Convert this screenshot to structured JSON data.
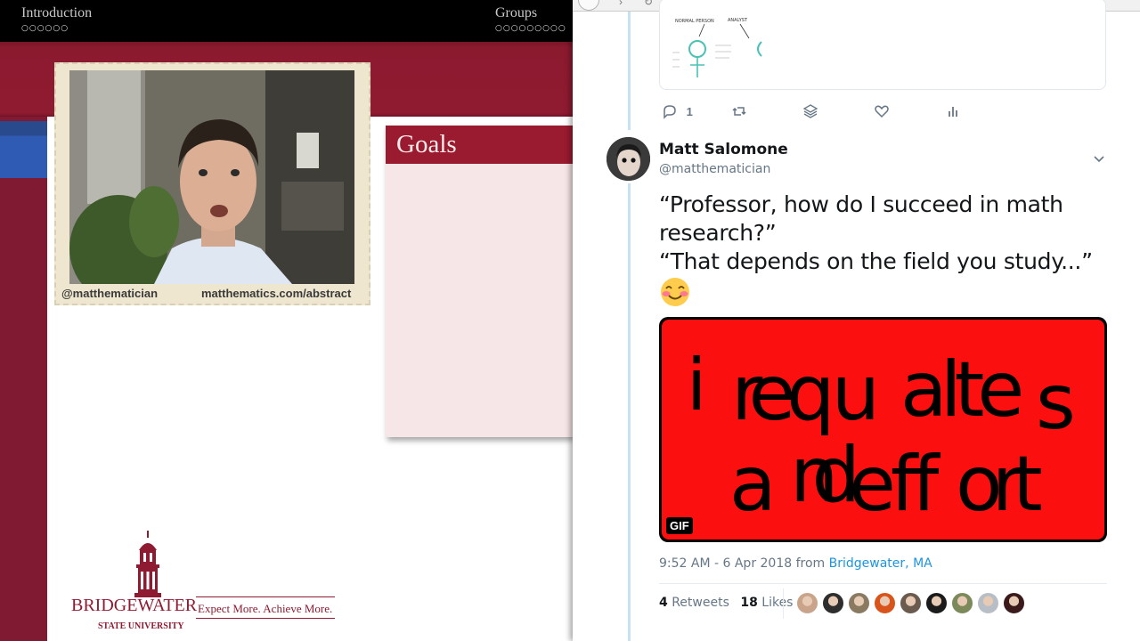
{
  "slide": {
    "nav": {
      "sections": [
        {
          "title": "Introduction",
          "dots": "○○○○○○"
        },
        {
          "title": "Groups",
          "dots": "○○○○○○○○○"
        }
      ]
    },
    "webcam_captions": {
      "handle": "@matthematician",
      "site": "matthematics.com/abstract"
    },
    "goals_title": "Goals",
    "logo": {
      "name": "BRIDGEWATER",
      "tagline": "Expect More. Achieve More.",
      "subtitle": "STATE UNIVERSITY"
    },
    "colors": {
      "maroon": "#8f1b31",
      "nav_black": "#000000",
      "blue_tab": "#2f5bb5"
    }
  },
  "tweet": {
    "quoted": {
      "labels": [
        "NORMAL PERSON",
        "ANALYST"
      ]
    },
    "actions": {
      "reply_count": "1"
    },
    "author": {
      "name": "Matt Salomone",
      "handle": "@matthematician"
    },
    "text_lines": [
      "“Professor, how do I succeed in math",
      "research?”",
      "“That depends on the field you study...”"
    ],
    "emoji": "blushing-smile",
    "gif": {
      "badge": "GIF",
      "background": "#fb0f0f"
    },
    "timestamp": "9:52 AM - 6 Apr 2018 from ",
    "location": "Bridgewater, MA",
    "retweets": {
      "count": "4",
      "label": "Retweets"
    },
    "likes": {
      "count": "18",
      "label": "Likes"
    },
    "liker_count": 9,
    "colors": {
      "link": "#1b95e0",
      "thread_line": "#c7e2f3",
      "muted": "#657786"
    }
  }
}
